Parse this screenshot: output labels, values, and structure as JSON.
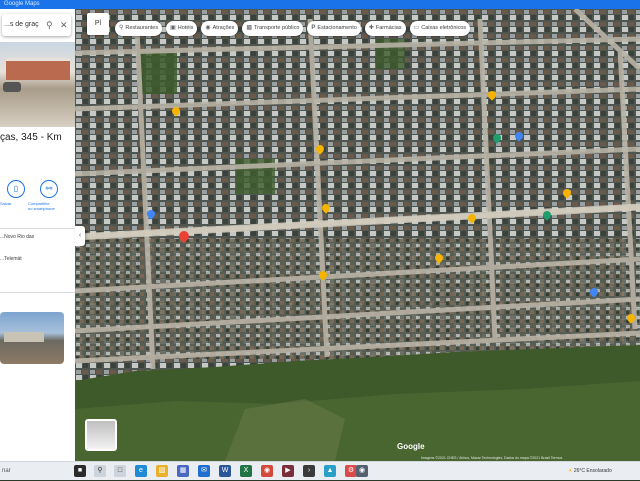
{
  "window": {
    "title": "Google Maps"
  },
  "panel": {
    "search_text": "...s de graç",
    "search_icon": "search-icon",
    "close_icon": "close-icon",
    "place_title": "ças, 345 - Km",
    "actions": [
      {
        "icon": "bookmark-icon",
        "label": "Salvar",
        "sublabel": ""
      },
      {
        "icon": "share-icon",
        "label": "Compartilhe",
        "sublabel": "no smartphone"
      }
    ],
    "info_lines": [
      "...Novo Rio das",
      "...Telemát"
    ],
    "collapse_icon": "chevron-left-icon"
  },
  "map": {
    "menu_label": "Pl",
    "chips": [
      {
        "icon": "restaurant-icon",
        "label": "Restaurantes"
      },
      {
        "icon": "hotel-icon",
        "label": "Hotéis"
      },
      {
        "icon": "camera-icon",
        "label": "Atrações"
      },
      {
        "icon": "bus-icon",
        "label": "Transporte público"
      },
      {
        "icon": "parking-icon",
        "label": "Estacionamento"
      },
      {
        "icon": "pharmacy-icon",
        "label": "Farmácias"
      },
      {
        "icon": "atm-icon",
        "label": "Caixas eletrônicos"
      }
    ],
    "watermark": "Google",
    "attribution": "Imagens ©2021 CNES / Airbus, Maxar Technologies, Dados do mapa ©2021  Brasil  Termos"
  },
  "taskbar": {
    "search_text": "nar",
    "apps": [
      "task-view",
      "edge",
      "explorer",
      "store",
      "mail",
      "word",
      "excel",
      "chrome",
      "media",
      "terminal",
      "photos",
      "settings",
      "maps"
    ],
    "weather": "26°C  Ensolarado",
    "clock": ""
  }
}
